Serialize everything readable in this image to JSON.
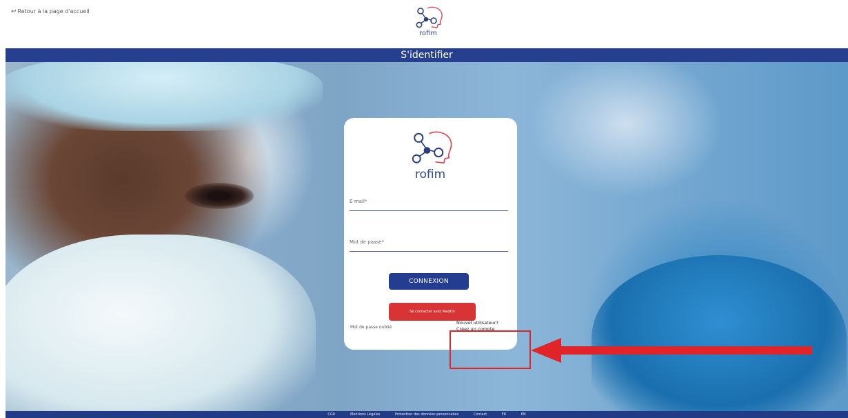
{
  "caption": "",
  "header": {
    "back_link": "Retour à la page d'accueil",
    "brand": "rofim",
    "title": "S'identifier"
  },
  "login_card": {
    "brand": "rofim",
    "email_placeholder": "E-mail*",
    "password_placeholder": "Mot de passe*",
    "connect_button": "CONNEXION",
    "medoc_button": "Se connecter avec MedOn",
    "forgot_password": "Mot de passe oublié",
    "new_user_line1": "Nouvel utilisateur?",
    "new_user_line2": "Créez un compte"
  },
  "annotations": {
    "highlight_color": "#e0242a",
    "arrow_color": "#e0242a"
  },
  "footer": {
    "links": [
      "CGU",
      "Mentions Légales",
      "Protection des données personnelles",
      "Contact",
      "FR",
      "EN"
    ]
  },
  "colors": {
    "primary": "#263f8f",
    "accent_red": "#d83435",
    "brand_text": "#334a8c"
  }
}
